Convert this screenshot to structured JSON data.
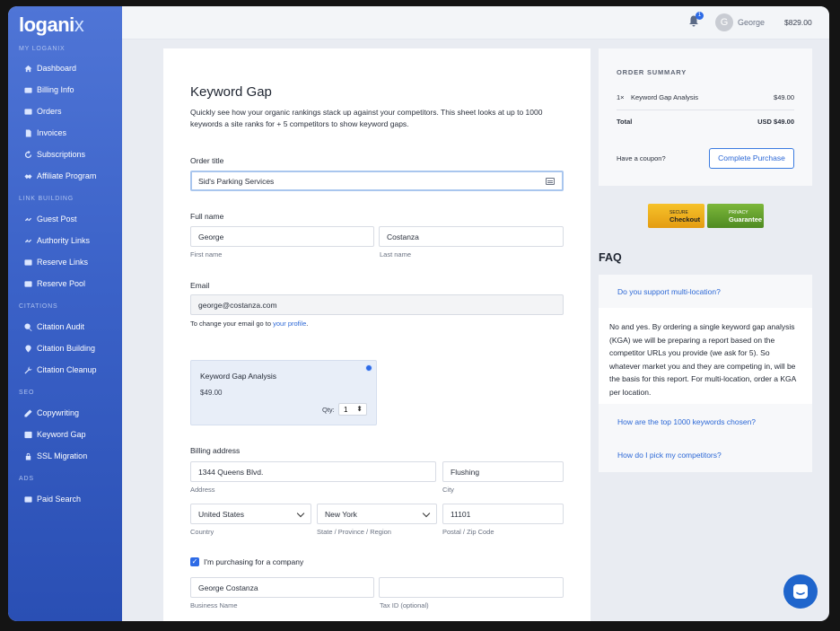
{
  "app": {
    "logo_main": "logani",
    "logo_x": "x"
  },
  "sidebar": {
    "sections": [
      {
        "title": "MY LOGANIX",
        "items": [
          "Dashboard",
          "Billing Info",
          "Orders",
          "Invoices",
          "Subscriptions",
          "Affiliate Program"
        ]
      },
      {
        "title": "LINK BUILDING",
        "items": [
          "Guest Post",
          "Authority Links",
          "Reserve Links",
          "Reserve Pool"
        ]
      },
      {
        "title": "CITATIONS",
        "items": [
          "Citation Audit",
          "Citation Building",
          "Citation Cleanup"
        ]
      },
      {
        "title": "SEO",
        "items": [
          "Copywriting",
          "Keyword Gap",
          "SSL Migration"
        ]
      },
      {
        "title": "ADS",
        "items": [
          "Paid Search"
        ]
      }
    ]
  },
  "topbar": {
    "notification_count": "1",
    "avatar_initial": "G",
    "user_name": "George",
    "balance": "$829.00"
  },
  "form": {
    "title": "Keyword Gap",
    "description": "Quickly see how your organic rankings stack up against your competitors. This sheet looks at up to 1000 keywords a site ranks for + 5 competitors to show keyword gaps.",
    "order_title_label": "Order title",
    "order_title_value": "Sid's Parking Services",
    "full_name_label": "Full name",
    "first_name": "George",
    "first_name_label": "First name",
    "last_name": "Costanza",
    "last_name_label": "Last name",
    "email_label": "Email",
    "email_value": "george@costanza.com",
    "email_help_prefix": "To change your email go to ",
    "email_help_link": "your profile",
    "email_help_suffix": ".",
    "product_name": "Keyword Gap Analysis",
    "product_price": "$49.00",
    "qty_label": "Qty:",
    "qty_value": "1",
    "billing_label": "Billing address",
    "address_value": "1344 Queens Blvd.",
    "address_label": "Address",
    "city_value": "Flushing",
    "city_label": "City",
    "country_value": "United States",
    "country_label": "Country",
    "state_value": "New York",
    "state_label": "State / Province / Region",
    "zip_value": "11101",
    "zip_label": "Postal / Zip Code",
    "company_check_label": "I'm purchasing for a company",
    "business_name_value": "George Costanza",
    "business_name_label": "Business Name",
    "tax_id_value": "",
    "tax_id_label": "Tax ID  (optional)"
  },
  "summary": {
    "heading": "ORDER SUMMARY",
    "line_qty": "1×",
    "line_item": "Keyword Gap Analysis",
    "line_price": "$49.00",
    "total_label": "Total",
    "total_value": "USD $49.00",
    "coupon_text": "Have a coupon?",
    "purchase_button": "Complete Purchase"
  },
  "seals": {
    "secure_small": "SECURE",
    "secure_big": "Checkout",
    "privacy_small": "PRIVACY",
    "privacy_big": "Guarantee"
  },
  "faq": {
    "title": "FAQ",
    "q1": "Do you support multi-location?",
    "a1": "No and yes. By ordering a single keyword gap analysis (KGA) we will be preparing a report based on the competitor URLs you provide (we ask for 5). So whatever market you and they are competing in, will be the basis for this report. For multi-location, order a KGA per location.",
    "q2": "How are the top 1000 keywords chosen?",
    "q3": "How do I pick my competitors?"
  }
}
